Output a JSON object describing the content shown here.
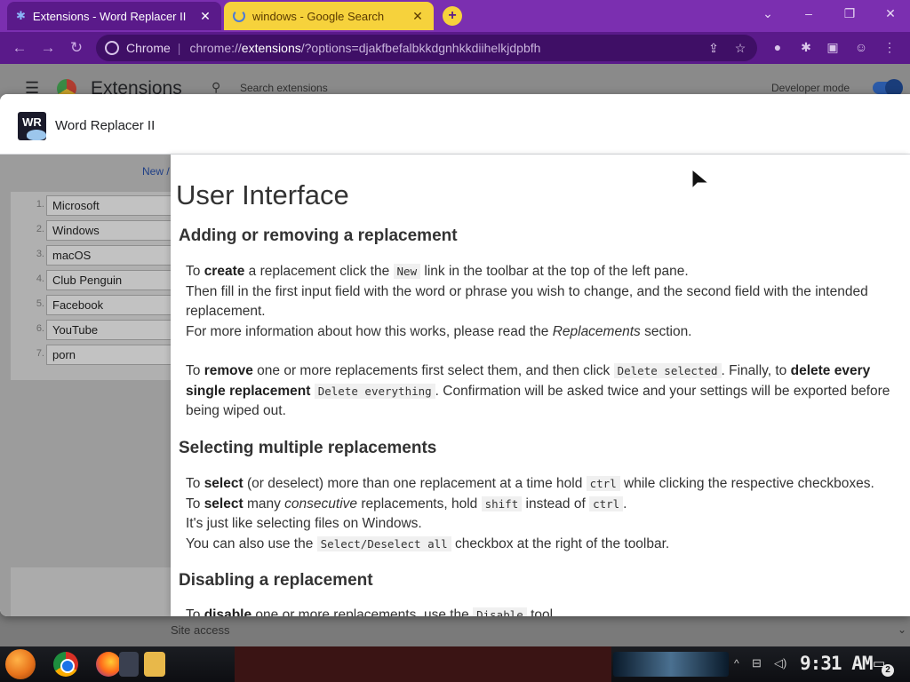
{
  "browser": {
    "tabs": [
      {
        "title": "Extensions - Word Replacer II",
        "icon": "puzzle-icon",
        "active": true
      },
      {
        "title": "windows - Google Search",
        "icon": "loading-spinner-icon",
        "active": false
      }
    ],
    "new_tab_label": "+",
    "window_controls": {
      "tab_search": "⌄",
      "minimize": "–",
      "restore": "❐",
      "close": "✕"
    },
    "omnibox": {
      "chip": "Chrome",
      "url_scheme": "chrome://",
      "url_host": "extensions",
      "url_rest": "/?options=djakfbefalbkkdgnhkkdiihelkjdpbfh"
    }
  },
  "extensions_page": {
    "title": "Extensions",
    "search_placeholder": "Search extensions",
    "developer_mode_label": "Developer mode",
    "developer_mode_on": true,
    "site_access_label": "Site access"
  },
  "dialog": {
    "title": "Word Replacer II",
    "icon_text": "WR",
    "left_toolbar": {
      "new_link": "New /"
    },
    "replacements": [
      {
        "num": "1.",
        "text": "Microsoft"
      },
      {
        "num": "2.",
        "text": "Windows"
      },
      {
        "num": "3.",
        "text": "macOS"
      },
      {
        "num": "4.",
        "text": "Club Penguin"
      },
      {
        "num": "5.",
        "text": "Facebook"
      },
      {
        "num": "6.",
        "text": "YouTube"
      },
      {
        "num": "7.",
        "text": "porn"
      }
    ],
    "help": {
      "title": "User Interface",
      "s1": {
        "heading": "Adding or removing a replacement",
        "p1_a": "To ",
        "p1_b": "create",
        "p1_c": " a replacement click the ",
        "p1_code": "New",
        "p1_d": " link in the toolbar at the top of the left pane.",
        "p1_e": "Then fill in the first input field with the word or phrase you wish to change, and the second field with the intended replacement.",
        "p1_f_a": "For more information about how this works, please read the ",
        "p1_f_em": "Replacements",
        "p1_f_b": " section.",
        "p2_a": "To ",
        "p2_b": "remove",
        "p2_c": " one or more replacements first select them, and then click ",
        "p2_code1": "Delete selected",
        "p2_d": ". Finally, to ",
        "p2_e": "delete every single replacement",
        "p2_code2": "Delete everything",
        "p2_f": ". Confirmation will be asked twice and your settings will be exported before being wiped out."
      },
      "s2": {
        "heading": "Selecting multiple replacements",
        "l1_a": "To ",
        "l1_b": "select",
        "l1_c": " (or deselect) more than one replacement at a time hold ",
        "l1_code": "ctrl",
        "l1_d": " while clicking the respective checkboxes.",
        "l2_a": "To ",
        "l2_b": "select",
        "l2_c": " many ",
        "l2_em": "consecutive",
        "l2_d": " replacements, hold ",
        "l2_code1": "shift",
        "l2_e": " instead of ",
        "l2_code2": "ctrl",
        "l2_f": ".",
        "l3": "It's just like selecting files on Windows.",
        "l4_a": "You can also use the ",
        "l4_code": "Select/Deselect all",
        "l4_b": " checkbox at the right of the toolbar."
      },
      "s3": {
        "heading": "Disabling a replacement",
        "l1_a": "To ",
        "l1_b": "disable",
        "l1_c": " one or more replacements, use the ",
        "l1_code": "Disable",
        "l1_d": " tool"
      }
    }
  },
  "taskbar": {
    "clock": "9:31 AM",
    "notification_count": "2",
    "icons": [
      "start-orb-icon",
      "chrome-icon",
      "firefox-icon",
      "media-player-icon",
      "file-explorer-icon"
    ]
  }
}
